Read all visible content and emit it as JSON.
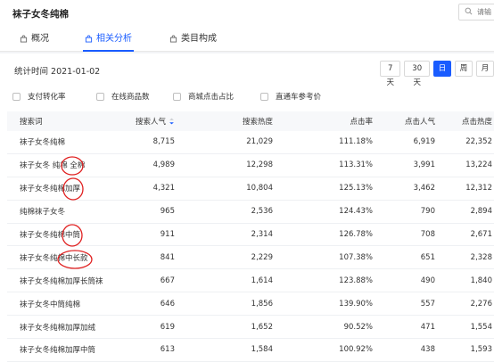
{
  "header": {
    "title": "袜子女冬纯棉",
    "search_placeholder": "请输"
  },
  "tabs": [
    {
      "label": "概况",
      "active": false
    },
    {
      "label": "相关分析",
      "active": true
    },
    {
      "label": "类目构成",
      "active": false
    }
  ],
  "stats": {
    "time_label": "统计时间 2021-01-02"
  },
  "periods": [
    {
      "label": "7天",
      "active": false
    },
    {
      "label": "30天",
      "active": false
    },
    {
      "label": "日",
      "active": true
    },
    {
      "label": "周",
      "active": false
    },
    {
      "label": "月",
      "active": false
    }
  ],
  "metrics": [
    "支付转化率",
    "在线商品数",
    "商城点击占比",
    "直通车参考价"
  ],
  "table": {
    "headers": [
      "搜索词",
      "搜索人气",
      "搜索热度",
      "点击率",
      "点击人气",
      "点击热度"
    ],
    "rows": [
      [
        "袜子女冬纯棉",
        "8,715",
        "21,029",
        "111.18%",
        "6,919",
        "22,352"
      ],
      [
        "袜子女冬 纯棉 全棉",
        "4,989",
        "12,298",
        "113.31%",
        "3,991",
        "13,224"
      ],
      [
        "袜子女冬纯棉加厚",
        "4,321",
        "10,804",
        "125.13%",
        "3,462",
        "12,312"
      ],
      [
        "纯棉袜子女冬",
        "965",
        "2,536",
        "124.43%",
        "790",
        "2,894"
      ],
      [
        "袜子女冬纯棉中筒",
        "911",
        "2,314",
        "126.78%",
        "708",
        "2,671"
      ],
      [
        "袜子女冬纯棉中长款",
        "841",
        "2,229",
        "107.38%",
        "651",
        "2,328"
      ],
      [
        "袜子女冬纯棉加厚长筒袜",
        "667",
        "1,614",
        "123.88%",
        "490",
        "1,840"
      ],
      [
        "袜子女冬中筒纯棉",
        "646",
        "1,856",
        "139.90%",
        "557",
        "2,276"
      ],
      [
        "袜子女冬纯棉加厚加绒",
        "619",
        "1,652",
        "90.52%",
        "471",
        "1,554"
      ],
      [
        "袜子女冬纯棉加厚中筒",
        "613",
        "1,584",
        "100.92%",
        "438",
        "1,593"
      ]
    ]
  },
  "colors": {
    "accent": "#1a5cff",
    "annotation": "#e02020"
  }
}
